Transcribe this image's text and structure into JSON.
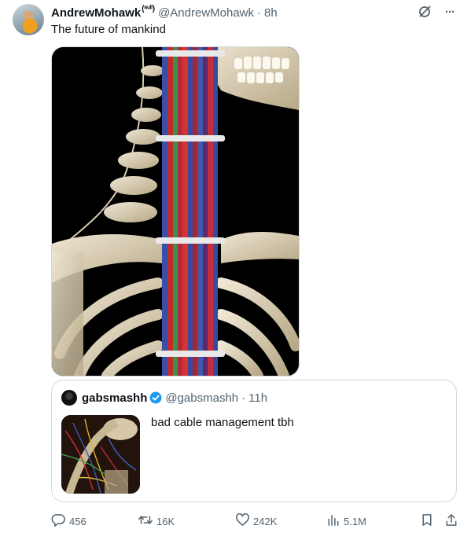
{
  "tweet": {
    "author_name": "AndrewMohawk",
    "author_name_sup": "(ᶰᵘˡˡ)",
    "author_handle": "@AndrewMohawk",
    "separator": "·",
    "time": "8h",
    "text": "The future of mankind",
    "more_label": "···"
  },
  "quote": {
    "author_name": "gabsmashh",
    "author_handle": "@gabsmashh",
    "separator": "·",
    "time": "11h",
    "text": "bad cable management tbh"
  },
  "actions": {
    "replies": "456",
    "reposts": "16K",
    "likes": "242K",
    "views": "5.1M"
  },
  "colors": {
    "text": "#0f1419",
    "secondary": "#536471",
    "border": "#cfd9de",
    "verified": "#1d9bf0"
  },
  "icons": [
    "grok-icon",
    "more-icon",
    "reply-icon",
    "repost-icon",
    "like-icon",
    "views-icon",
    "bookmark-icon",
    "share-icon",
    "verified-icon"
  ]
}
